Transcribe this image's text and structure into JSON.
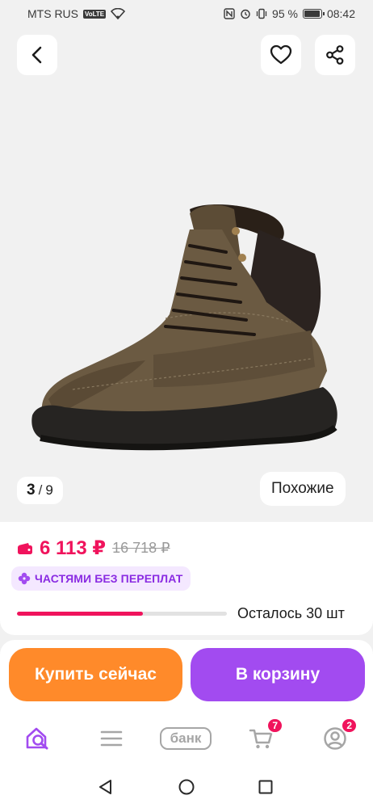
{
  "status_bar": {
    "carrier": "MTS RUS",
    "network_badge": "VoLTE",
    "battery_text": "95 %",
    "battery_level": 0.95,
    "time": "08:42"
  },
  "product": {
    "gallery_current": "3",
    "gallery_separator": "/",
    "gallery_total": "9",
    "similar_label": "Похожие"
  },
  "pricing": {
    "current_price": "6 113 ₽",
    "old_price": "16 718 ₽",
    "installments_label": "ЧАСТЯМИ БЕЗ ПЕРЕПЛАТ",
    "stock_text": "Осталось 30 шт",
    "stock_fraction": 0.6
  },
  "actions": {
    "buy_now_label": "Купить сейчас",
    "add_to_cart_label": "В корзину"
  },
  "tab_bar": {
    "bank_label": "банк",
    "cart_badge": "7",
    "profile_badge": "2"
  },
  "colors": {
    "accent_pink": "#f0135c",
    "buy_orange": "#ff8a2a",
    "cart_purple": "#a24bf0"
  },
  "icons": [
    "back-arrow-icon",
    "heart-icon",
    "share-icon",
    "wallet-icon",
    "installments-flower-icon",
    "home-search-icon",
    "catalog-menu-icon",
    "cart-icon",
    "profile-icon",
    "nav-back-icon",
    "nav-home-icon",
    "nav-recent-icon"
  ]
}
